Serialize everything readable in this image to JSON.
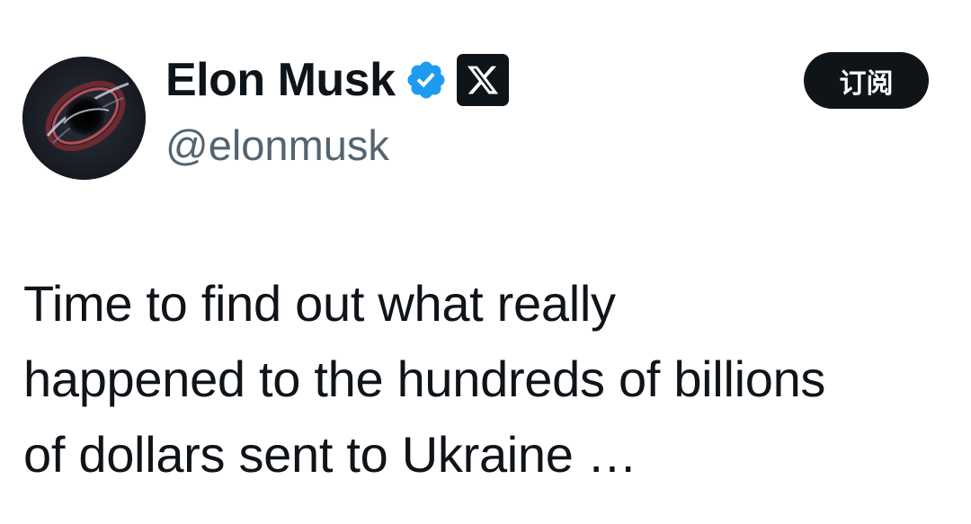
{
  "author": {
    "display_name": "Elon Musk",
    "handle": "@elonmusk",
    "avatar_icon": "black-hole-avatar",
    "verified_icon": "verified-badge-icon",
    "affiliation_icon": "x-logo-icon"
  },
  "actions": {
    "subscribe_label": "订阅"
  },
  "tweet": {
    "lines": [
      "Time to find out what really",
      "happened to the hundreds of billions",
      "of dollars sent to Ukraine …"
    ]
  },
  "colors": {
    "text_primary": "#0f1419",
    "text_secondary": "#536471",
    "verified_blue": "#1d9bf0",
    "button_bg": "#0f1419",
    "background": "#ffffff"
  }
}
